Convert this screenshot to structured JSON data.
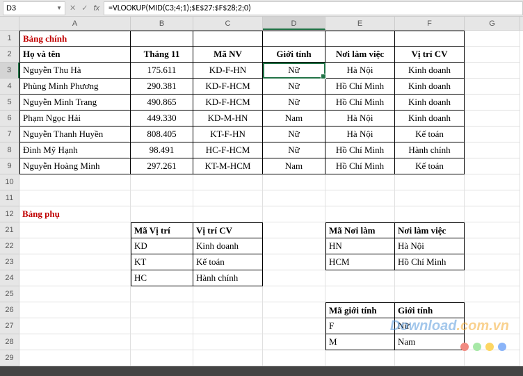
{
  "nameBox": "D3",
  "formula": "=VLOOKUP(MID(C3;4;1);$E$27:$F$28;2;0)",
  "columns": [
    "A",
    "B",
    "C",
    "D",
    "E",
    "F",
    "G"
  ],
  "activeCol": "D",
  "activeRow": 3,
  "rows": [
    1,
    2,
    3,
    4,
    5,
    6,
    7,
    8,
    9,
    10,
    11,
    12,
    21,
    22,
    23,
    24,
    25,
    26,
    27,
    28,
    29
  ],
  "title1": "Bảng chính",
  "title2": "Bảng phụ",
  "header": {
    "name": "Họ và tên",
    "month": "Tháng 11",
    "code": "Mã NV",
    "sex": "Giới tính",
    "place": "Nơi làm việc",
    "pos": "Vị trí CV"
  },
  "data": [
    {
      "name": "Nguyễn Thu Hà",
      "month": "175.611",
      "code": "KD-F-HN",
      "sex": "Nữ",
      "place": "Hà Nội",
      "pos": "Kinh doanh"
    },
    {
      "name": "Phùng Minh Phương",
      "month": "290.381",
      "code": "KD-F-HCM",
      "sex": "Nữ",
      "place": "Hồ Chí Minh",
      "pos": "Kinh doanh"
    },
    {
      "name": "Nguyễn Minh Trang",
      "month": "490.865",
      "code": "KD-F-HCM",
      "sex": "Nữ",
      "place": "Hồ Chí Minh",
      "pos": "Kinh doanh"
    },
    {
      "name": "Phạm Ngọc Hải",
      "month": "449.330",
      "code": "KD-M-HN",
      "sex": "Nam",
      "place": "Hà Nội",
      "pos": "Kinh doanh"
    },
    {
      "name": "Nguyễn Thanh Huyền",
      "month": "808.405",
      "code": "KT-F-HN",
      "sex": "Nữ",
      "place": "Hà Nội",
      "pos": "Kế toán"
    },
    {
      "name": "Đinh Mỹ Hạnh",
      "month": "98.491",
      "code": "HC-F-HCM",
      "sex": "Nữ",
      "place": "Hồ Chí Minh",
      "pos": "Hành chính"
    },
    {
      "name": "Nguyễn Hoàng Minh",
      "month": "297.261",
      "code": "KT-M-HCM",
      "sex": "Nam",
      "place": "Hồ Chí Minh",
      "pos": "Kế toán"
    }
  ],
  "posHeader": {
    "code": "Mã Vị trí",
    "name": "Vị trí CV"
  },
  "positions": [
    {
      "code": "KD",
      "name": "Kinh doanh"
    },
    {
      "code": "KT",
      "name": "Kế toán"
    },
    {
      "code": "HC",
      "name": "Hành chính"
    }
  ],
  "placeHeader": {
    "code": "Mã Nơi làm",
    "name": "Nơi làm việc"
  },
  "places": [
    {
      "code": "HN",
      "name": "Hà Nội"
    },
    {
      "code": "HCM",
      "name": "Hồ Chí Minh"
    }
  ],
  "sexHeader": {
    "code": "Mã giới tính",
    "name": "Giới tính"
  },
  "sexes": [
    {
      "code": "F",
      "name": "Nữ"
    },
    {
      "code": "M",
      "name": "Nam"
    }
  ],
  "watermark": {
    "a": "Down",
    "b": "load",
    "c": ".com.vn"
  }
}
